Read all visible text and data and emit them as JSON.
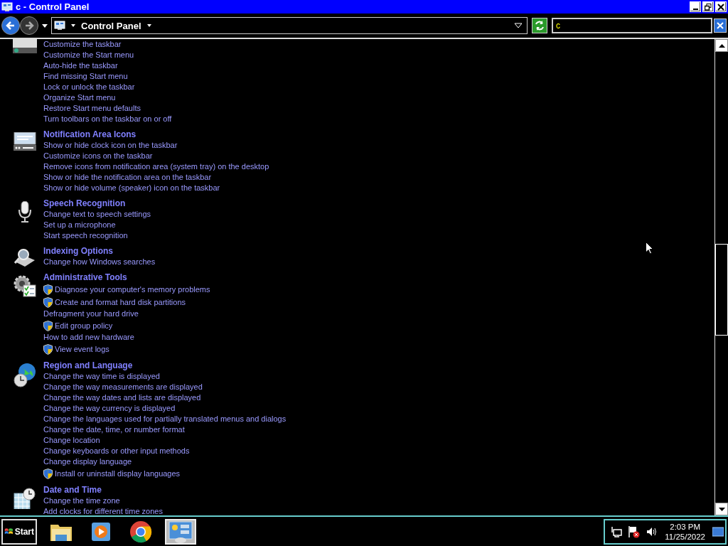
{
  "window": {
    "title": "c - Control Panel"
  },
  "address_bar": {
    "breadcrumb": "Control Panel",
    "search_value": "c"
  },
  "groups": [
    {
      "links": [
        {
          "text": "Customize the taskbar",
          "shield": false
        },
        {
          "text": "Customize the Start menu",
          "shield": false
        },
        {
          "text": "Auto-hide the taskbar",
          "shield": false
        },
        {
          "text": "Find missing Start menu",
          "shield": false
        },
        {
          "text": "Lock or unlock the taskbar",
          "shield": false
        },
        {
          "text": "Organize Start menu",
          "shield": false
        },
        {
          "text": "Restore Start menu defaults",
          "shield": false
        },
        {
          "text": "Turn toolbars on the taskbar on or off",
          "shield": false
        }
      ]
    },
    {
      "title": "Notification Area Icons",
      "links": [
        {
          "text": "Show or hide clock icon on the taskbar",
          "shield": false
        },
        {
          "text": "Customize icons on the taskbar",
          "shield": false
        },
        {
          "text": "Remove icons from notification area (system tray) on the desktop",
          "shield": false
        },
        {
          "text": "Show or hide the notification area on the taskbar",
          "shield": false
        },
        {
          "text": "Show or hide volume (speaker) icon on the taskbar",
          "shield": false
        }
      ]
    },
    {
      "title": "Speech Recognition",
      "links": [
        {
          "text": "Change text to speech settings",
          "shield": false
        },
        {
          "text": "Set up a microphone",
          "shield": false
        },
        {
          "text": "Start speech recognition",
          "shield": false
        }
      ]
    },
    {
      "title": "Indexing Options",
      "links": [
        {
          "text": "Change how Windows searches",
          "shield": false
        }
      ]
    },
    {
      "title": "Administrative Tools",
      "links": [
        {
          "text": "Diagnose your computer's memory problems",
          "shield": true
        },
        {
          "text": "Create and format hard disk partitions",
          "shield": true
        },
        {
          "text": "Defragment your hard drive",
          "shield": false
        },
        {
          "text": "Edit group policy",
          "shield": true
        },
        {
          "text": "How to add new hardware",
          "shield": false
        },
        {
          "text": "View event logs",
          "shield": true
        }
      ]
    },
    {
      "title": "Region and Language",
      "links": [
        {
          "text": "Change the way time is displayed",
          "shield": false
        },
        {
          "text": "Change the way measurements are displayed",
          "shield": false
        },
        {
          "text": "Change the way dates and lists are displayed",
          "shield": false
        },
        {
          "text": "Change the way currency is displayed",
          "shield": false
        },
        {
          "text": "Change the languages used for partially translated menus and dialogs",
          "shield": false
        },
        {
          "text": "Change the date, time, or number format",
          "shield": false
        },
        {
          "text": "Change location",
          "shield": false
        },
        {
          "text": "Change keyboards or other input methods",
          "shield": false
        },
        {
          "text": "Change display language",
          "shield": false
        },
        {
          "text": "Install or uninstall display languages",
          "shield": true
        }
      ]
    },
    {
      "title": "Date and Time",
      "links": [
        {
          "text": "Change the time zone",
          "shield": false
        },
        {
          "text": "Add clocks for different time zones",
          "shield": false
        }
      ]
    }
  ],
  "taskbar": {
    "start": "Start",
    "apps": [
      {
        "selected": false
      },
      {
        "selected": false
      },
      {
        "selected": false
      },
      {
        "selected": true
      }
    ],
    "clock": {
      "time": "2:03 PM",
      "date": "11/25/2022"
    }
  }
}
